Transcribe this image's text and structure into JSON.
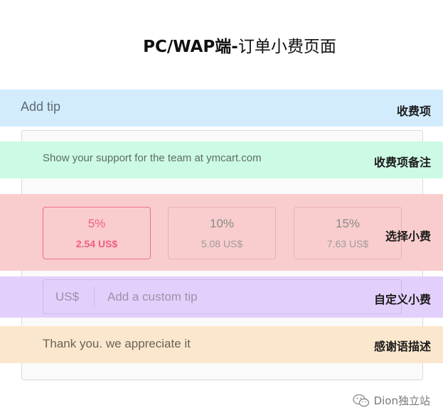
{
  "header": {
    "title_bold": "PC/WAP端-",
    "title_rest": "订单小费页面"
  },
  "tip_section": {
    "label": "Add tip",
    "annotation": "收费项"
  },
  "support": {
    "text": "Show your support for the team at ymcart.com",
    "annotation": "收费项备注"
  },
  "tip_options": {
    "annotation": "选择小费",
    "selected_index": 0,
    "items": [
      {
        "percent": "5%",
        "amount": "2.54 US$"
      },
      {
        "percent": "10%",
        "amount": "5.08 US$"
      },
      {
        "percent": "15%",
        "amount": "7.63 US$"
      }
    ]
  },
  "custom_tip": {
    "prefix": "US$",
    "placeholder": "Add a custom tip",
    "annotation": "自定义小费"
  },
  "thanks": {
    "text": "Thank you. we appreciate it",
    "annotation": "感谢语描述"
  },
  "watermark": {
    "text": "Dion独立站",
    "icon": "wechat-icon"
  },
  "colors": {
    "tip_band": "#d2ecfd",
    "support_band": "#cdfae5",
    "select_band": "#f9cdcd",
    "custom_band": "#e3cffb",
    "thanks_band": "#fbe7cd",
    "accent": "#ee5e86"
  }
}
